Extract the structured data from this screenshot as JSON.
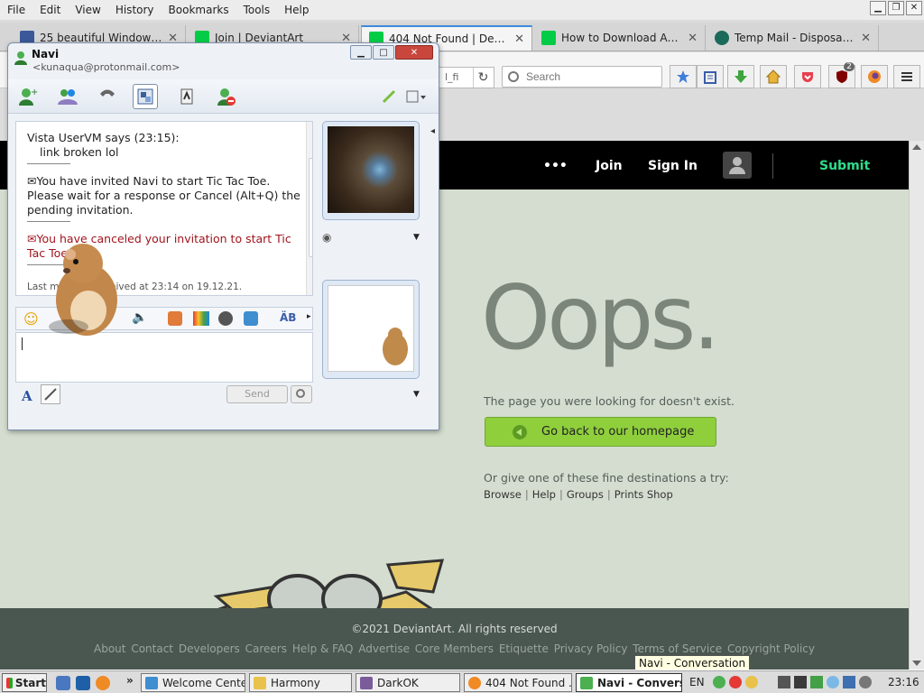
{
  "menubar": {
    "items": [
      "File",
      "Edit",
      "View",
      "History",
      "Bookmarks",
      "Tools",
      "Help"
    ]
  },
  "tabs": [
    {
      "label": "25 beautiful Windows V..."
    },
    {
      "label": "Join | DeviantArt"
    },
    {
      "label": "404 Not Found | Devian..."
    },
    {
      "label": "How to Download Any ..."
    },
    {
      "label": "Temp Mail - Disposabl..."
    }
  ],
  "nav": {
    "url_fragment": "l_fi",
    "search_placeholder": "Search",
    "ublock_badge": "2"
  },
  "deviantart": {
    "more": "•••",
    "join": "Join",
    "signin": "Sign In",
    "submit": "Submit",
    "oops": "Oops.",
    "not_exist": "The page you were looking for doesn't exist.",
    "home_button": "Go back to our homepage",
    "or_give": "Or give one of these fine destinations a try:",
    "destinations": [
      "Browse",
      "Help",
      "Groups",
      "Prints Shop"
    ],
    "copyright": "©2021 DeviantArt. All rights reserved",
    "footer_links": [
      "About",
      "Contact",
      "Developers",
      "Careers",
      "Help & FAQ",
      "Advertise",
      "Core Members",
      "Etiquette",
      "Privacy Policy",
      "Terms of Service",
      "Copyright Policy"
    ]
  },
  "messenger": {
    "title": "Navi",
    "email": "<kunaqua@protonmail.com>",
    "conversation": {
      "sender_line": "Vista UserVM says (23:15):",
      "message": "link broken lol",
      "invite_1": "You have invited Navi to start Tic Tac Toe.",
      "invite_2": "Please wait for a response or Cancel (Alt+Q) the",
      "invite_3": "pending invitation.",
      "cancel_1": "You have canceled your invitation to start Tic",
      "cancel_2": "Tac Toe.",
      "last_message": "Last message received at 23:14 on 19.12.21."
    },
    "send_label": "Send"
  },
  "tooltip": "Navi - Conversation",
  "taskbar": {
    "start": "Start",
    "tasks": [
      "Welcome Center",
      "Harmony",
      "DarkOK",
      "404 Not Found ...",
      "Navi - Convers..."
    ],
    "lang": "EN",
    "clock": "23:16"
  }
}
